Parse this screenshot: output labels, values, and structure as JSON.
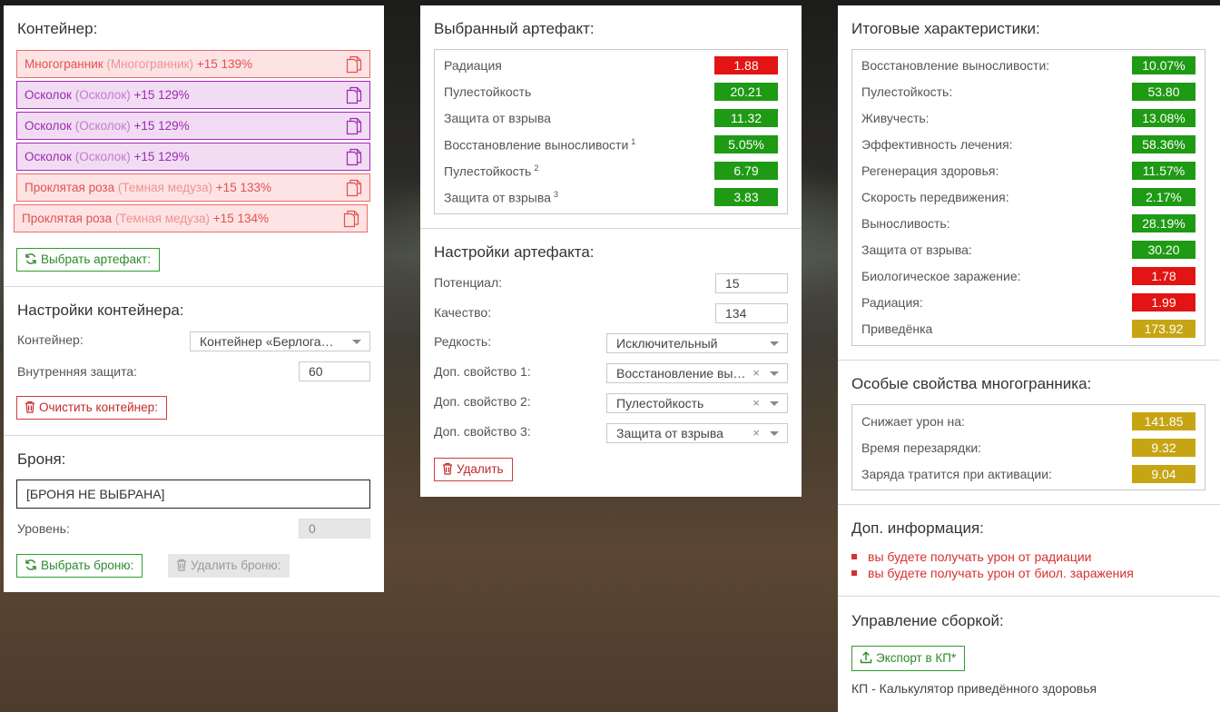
{
  "container": {
    "title": "Контейнер:",
    "items": [
      {
        "name": "Многогранник",
        "base": "(Многогранник)",
        "stats": "+15 139%",
        "color": "red"
      },
      {
        "name": "Осколок",
        "base": "(Осколок)",
        "stats": "+15 129%",
        "color": "purple"
      },
      {
        "name": "Осколок",
        "base": "(Осколок)",
        "stats": "+15 129%",
        "color": "purple"
      },
      {
        "name": "Осколок",
        "base": "(Осколок)",
        "stats": "+15 129%",
        "color": "purple"
      },
      {
        "name": "Проклятая роза",
        "base": "(Темная медуза)",
        "stats": "+15 133%",
        "color": "red"
      },
      {
        "name": "Проклятая роза",
        "base": "(Темная медуза)",
        "stats": "+15 134%",
        "color": "red"
      }
    ],
    "select_artifact_button": "Выбрать артефакт:"
  },
  "container_settings": {
    "title": "Настройки контейнера:",
    "container_label": "Контейнер:",
    "container_value": "Контейнер «Берлога…",
    "inner_protection_label": "Внутренняя защита:",
    "inner_protection_value": "60",
    "clear_button": "Очистить контейнер:"
  },
  "armor": {
    "title": "Броня:",
    "selected_value": "[БРОНЯ НЕ ВЫБРАНА]",
    "level_label": "Уровень:",
    "level_value": "0",
    "select_button": "Выбрать броню:",
    "delete_button": "Удалить броню:"
  },
  "selected_artifact": {
    "title": "Выбранный артефакт:",
    "stats": [
      {
        "label": "Радиация",
        "sup": "",
        "value": "1.88",
        "color": "r"
      },
      {
        "label": "Пулестойкость",
        "sup": "",
        "value": "20.21",
        "color": "g"
      },
      {
        "label": "Защита от взрыва",
        "sup": "",
        "value": "11.32",
        "color": "g"
      },
      {
        "label": "Восстановление выносливости",
        "sup": "1",
        "value": "5.05%",
        "color": "g"
      },
      {
        "label": "Пулестойкость",
        "sup": "2",
        "value": "6.79",
        "color": "g"
      },
      {
        "label": "Защита от взрыва",
        "sup": "3",
        "value": "3.83",
        "color": "g"
      }
    ]
  },
  "artifact_settings": {
    "title": "Настройки артефакта:",
    "potential_label": "Потенциал:",
    "potential_value": "15",
    "quality_label": "Качество:",
    "quality_value": "134",
    "rarity_label": "Редкость:",
    "rarity_value": "Исключительный",
    "extra1_label": "Доп. свойство 1:",
    "extra1_value": "Восстановление выносливости",
    "extra2_label": "Доп. свойство 2:",
    "extra2_value": "Пулестойкость",
    "extra3_label": "Доп. свойство 3:",
    "extra3_value": "Защита от взрыва",
    "delete_button": "Удалить",
    "clear_symbol": "×"
  },
  "totals": {
    "title": "Итоговые характеристики:",
    "stats": [
      {
        "label": "Восстановление выносливости:",
        "value": "10.07%",
        "color": "g"
      },
      {
        "label": "Пулестойкость:",
        "value": "53.80",
        "color": "g"
      },
      {
        "label": "Живучесть:",
        "value": "13.08%",
        "color": "g"
      },
      {
        "label": "Эффективность лечения:",
        "value": "58.36%",
        "color": "g"
      },
      {
        "label": "Регенерация здоровья:",
        "value": "11.57%",
        "color": "g"
      },
      {
        "label": "Скорость передвижения:",
        "value": "2.17%",
        "color": "g"
      },
      {
        "label": "Выносливость:",
        "value": "28.19%",
        "color": "g"
      },
      {
        "label": "Защита от взрыва:",
        "value": "30.20",
        "color": "g"
      },
      {
        "label": "Биологическое заражение:",
        "value": "1.78",
        "color": "r"
      },
      {
        "label": "Радиация:",
        "value": "1.99",
        "color": "r"
      },
      {
        "label": "Приведёнка",
        "value": "173.92",
        "color": "y"
      }
    ]
  },
  "special": {
    "title": "Особые свойства многогранника:",
    "stats": [
      {
        "label": "Снижает урон на:",
        "value": "141.85",
        "color": "y"
      },
      {
        "label": "Время перезарядки:",
        "value": "9.32",
        "color": "y"
      },
      {
        "label": "Заряда тратится при активации:",
        "value": "9.04",
        "color": "y"
      }
    ]
  },
  "extra_info": {
    "title": "Доп. информация:",
    "items": [
      "вы будете получать урон от радиации",
      "вы будете получать урон от биол. заражения"
    ]
  },
  "build": {
    "title": "Управление сборкой:",
    "export_button": "Экспорт в КП*",
    "footnote": "КП - Калькулятор приведённого здоровья"
  },
  "colors": {
    "green": "#1e9a14",
    "red": "#e21414",
    "yellow": "#c6a514",
    "purple": "#9c2bb0",
    "item_red": "#e35151"
  }
}
